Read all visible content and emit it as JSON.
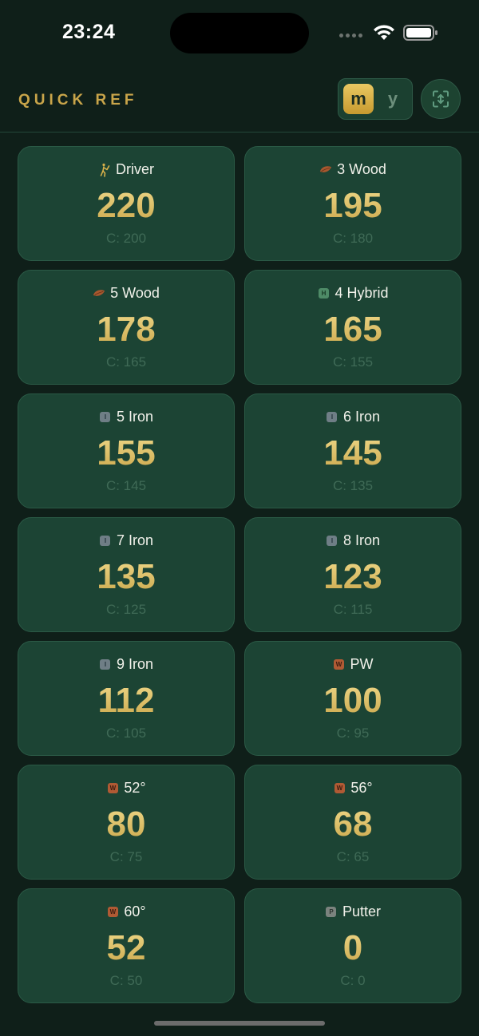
{
  "status": {
    "time": "23:24"
  },
  "header": {
    "title": "QUICK REF",
    "units": {
      "active": "m",
      "inactive": "y"
    },
    "rotate_button_icon": "rotate-screen-icon"
  },
  "clubs": [
    {
      "name": "Driver",
      "icon": "golfer-icon",
      "distance": "220",
      "carry": "C: 200"
    },
    {
      "name": "3 Wood",
      "icon": "wood-icon",
      "distance": "195",
      "carry": "C: 180"
    },
    {
      "name": "5 Wood",
      "icon": "wood-icon",
      "distance": "178",
      "carry": "C: 165"
    },
    {
      "name": "4 Hybrid",
      "icon": "hybrid-icon",
      "badge": "H",
      "distance": "165",
      "carry": "C: 155"
    },
    {
      "name": "5 Iron",
      "icon": "iron-icon",
      "badge": "I",
      "distance": "155",
      "carry": "C: 145"
    },
    {
      "name": "6 Iron",
      "icon": "iron-icon",
      "badge": "I",
      "distance": "145",
      "carry": "C: 135"
    },
    {
      "name": "7 Iron",
      "icon": "iron-icon",
      "badge": "I",
      "distance": "135",
      "carry": "C: 125"
    },
    {
      "name": "8 Iron",
      "icon": "iron-icon",
      "badge": "I",
      "distance": "123",
      "carry": "C: 115"
    },
    {
      "name": "9 Iron",
      "icon": "iron-icon",
      "badge": "I",
      "distance": "112",
      "carry": "C: 105"
    },
    {
      "name": "PW",
      "icon": "wedge-icon",
      "badge": "W",
      "distance": "100",
      "carry": "C: 95"
    },
    {
      "name": "52°",
      "icon": "wedge-icon",
      "badge": "W",
      "distance": "80",
      "carry": "C: 75"
    },
    {
      "name": "56°",
      "icon": "wedge-icon",
      "badge": "W",
      "distance": "68",
      "carry": "C: 65"
    },
    {
      "name": "60°",
      "icon": "wedge-icon",
      "badge": "W",
      "distance": "52",
      "carry": "C: 50"
    },
    {
      "name": "Putter",
      "icon": "putter-icon",
      "badge": "P",
      "distance": "0",
      "carry": "C: 0"
    }
  ],
  "colors": {
    "background": "#0f1f19",
    "card": "#1c4434",
    "gold": "#c9a54a",
    "carry_text": "#3f6a56"
  }
}
